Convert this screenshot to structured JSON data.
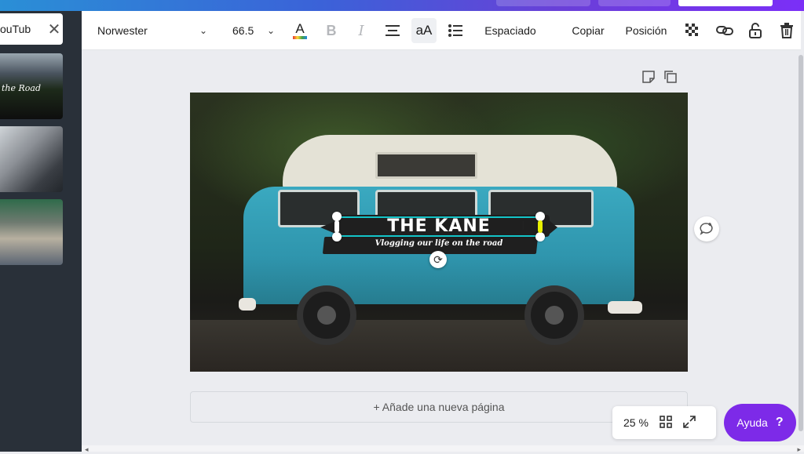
{
  "sidebar": {
    "search_value": "ouTub",
    "thumb_captions": [
      "the Road"
    ]
  },
  "toolbar": {
    "font_name": "Norwester",
    "font_size": "66.5",
    "spacing_label": "Espaciado",
    "copy_label": "Copiar",
    "position_label": "Posición"
  },
  "design": {
    "title": "THE KANE",
    "subtitle": "Vlogging our life on the road"
  },
  "add_page_label": "+ Añade una nueva página",
  "zoom": {
    "value": "25 %"
  },
  "help": {
    "label": "Ayuda",
    "icon": "?"
  },
  "colors": {
    "accent": "#7d2ae8",
    "selection": "#13c4c8",
    "sidebar": "#293039"
  }
}
